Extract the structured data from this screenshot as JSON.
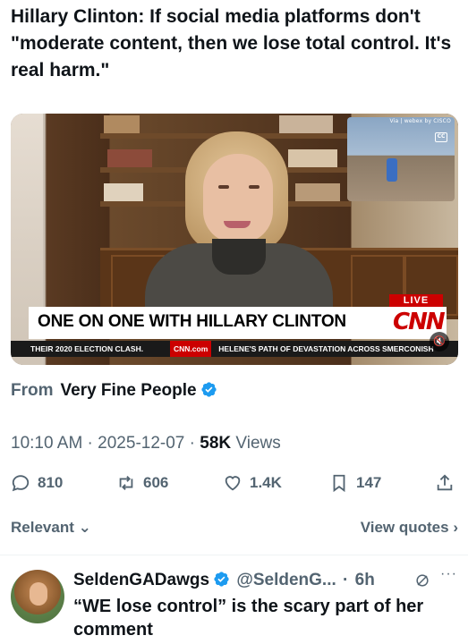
{
  "post": {
    "text": "Hillary Clinton: If social media platforms don't \"moderate content, then we lose total control. It's real harm.\""
  },
  "media": {
    "inset_label": "Via | webex by CISCO",
    "cc_label": "CC",
    "live_label": "LIVE",
    "headline": "ONE ON ONE WITH HILLARY CLINTON",
    "cnn_logo": "CNN",
    "ticker_left": "THEIR 2020 ELECTION CLASH.",
    "ticker_cnn": "CNN.com",
    "ticker_right": "HELENE'S PATH OF DEVASTATION ACROSS SMERCONISH",
    "mute_icon": "speaker-muted-icon"
  },
  "source": {
    "label": "From",
    "name": "Very Fine People",
    "verified_color": "#1d9bf0"
  },
  "meta": {
    "time": "10:10 AM",
    "date": "2025-12-07",
    "views_count": "58K",
    "views_label": "Views"
  },
  "actions": {
    "replies": "810",
    "reposts": "606",
    "likes": "1.4K",
    "bookmarks": "147"
  },
  "filter": {
    "relevant_label": "Relevant",
    "quotes_label": "View quotes"
  },
  "reply": {
    "name": "SeldenGADawgs",
    "handle": "@SeldenG...",
    "time": "6h",
    "text": "“WE lose control” is the scary part of her comment"
  },
  "colors": {
    "text_primary": "#0f1419",
    "text_secondary": "#536471",
    "accent": "#1d9bf0",
    "cnn_red": "#cc0000"
  }
}
